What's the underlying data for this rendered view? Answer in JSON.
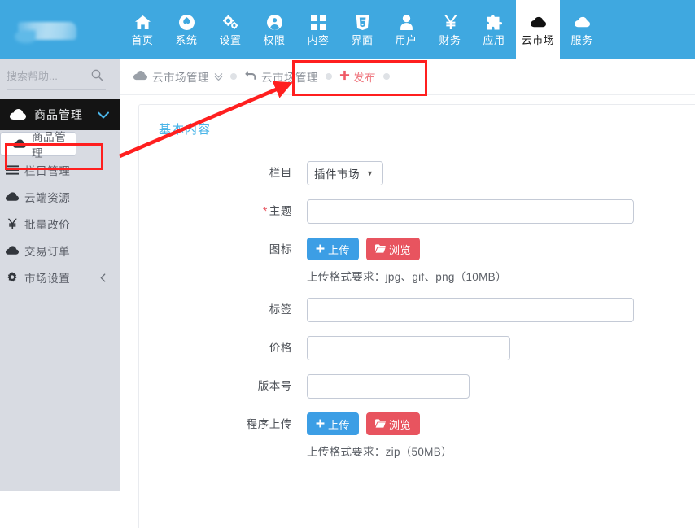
{
  "app": {
    "logo_alt": "blurred-logo",
    "accent_blue": "#3fa8e0",
    "accent_red": "#e8545f",
    "button_blue": "#3c9ee5",
    "title_blue": "#4bb5e8"
  },
  "topnav": {
    "items": [
      {
        "label": "首页",
        "icon": "home-icon",
        "active": false
      },
      {
        "label": "系统",
        "icon": "globe-icon",
        "active": false
      },
      {
        "label": "设置",
        "icon": "gears-icon",
        "active": false
      },
      {
        "label": "权限",
        "icon": "user-circle-icon",
        "active": false
      },
      {
        "label": "内容",
        "icon": "grid-icon",
        "active": false
      },
      {
        "label": "界面",
        "icon": "html5-icon",
        "active": false
      },
      {
        "label": "用户",
        "icon": "person-icon",
        "active": false
      },
      {
        "label": "财务",
        "icon": "yen-icon",
        "active": false
      },
      {
        "label": "应用",
        "icon": "puzzle-icon",
        "active": false
      },
      {
        "label": "云市场",
        "icon": "cloud-icon",
        "active": true
      },
      {
        "label": "服务",
        "icon": "cloud-icon",
        "active": false
      }
    ]
  },
  "sidebar": {
    "search": {
      "placeholder": "搜索帮助...",
      "value": "",
      "icon": "search-icon"
    },
    "section": {
      "label": "商品管理",
      "icon": "cloud-icon",
      "chevron": "chevron-down-icon"
    },
    "items": [
      {
        "label": "商品管理",
        "icon": "cloud-icon",
        "selected": true,
        "chevron": ""
      },
      {
        "label": "栏目管理",
        "icon": "list-icon",
        "selected": false,
        "chevron": ""
      },
      {
        "label": "云端资源",
        "icon": "cloud-icon",
        "selected": false,
        "chevron": ""
      },
      {
        "label": "批量改价",
        "icon": "yen-icon",
        "selected": false,
        "chevron": ""
      },
      {
        "label": "交易订单",
        "icon": "cloud-icon",
        "selected": false,
        "chevron": ""
      },
      {
        "label": "市场设置",
        "icon": "gear-icon",
        "selected": false,
        "chevron": "chevron-left-icon"
      }
    ]
  },
  "breadcrumb": {
    "root": {
      "label": "云市场管理",
      "icon": "cloud-icon",
      "chevron": "chevrons-down-icon"
    },
    "back": {
      "label": "云市场管理",
      "icon": "back-arrow-icon"
    },
    "action": {
      "label": "发布",
      "icon": "plus-icon"
    }
  },
  "card": {
    "title": "基本内容",
    "form": [
      {
        "label": "栏目",
        "required": false,
        "type": "select",
        "value": "插件市场",
        "options": [
          "插件市场"
        ]
      },
      {
        "label": "主题",
        "required": true,
        "type": "text",
        "value": "",
        "placeholder": ""
      },
      {
        "label": "图标",
        "required": false,
        "type": "upload",
        "upload_label": "上传",
        "browse_label": "浏览",
        "hint": "上传格式要求：jpg、gif、png（10MB）"
      },
      {
        "label": "标签",
        "required": false,
        "type": "text",
        "value": "",
        "placeholder": ""
      },
      {
        "label": "价格",
        "required": false,
        "type": "text",
        "value": "",
        "placeholder": ""
      },
      {
        "label": "版本号",
        "required": false,
        "type": "text",
        "value": "",
        "placeholder": ""
      },
      {
        "label": "程序上传",
        "required": false,
        "type": "upload",
        "upload_label": "上传",
        "browse_label": "浏览",
        "hint": "上传格式要求：zip（50MB）"
      }
    ]
  },
  "annotations": {
    "color": "#ff1f1f",
    "boxes": [
      "sidebar-item-goods-management",
      "breadcrumb-publish-area"
    ],
    "arrow": "arrow-from-sidebar-to-breadcrumb"
  }
}
